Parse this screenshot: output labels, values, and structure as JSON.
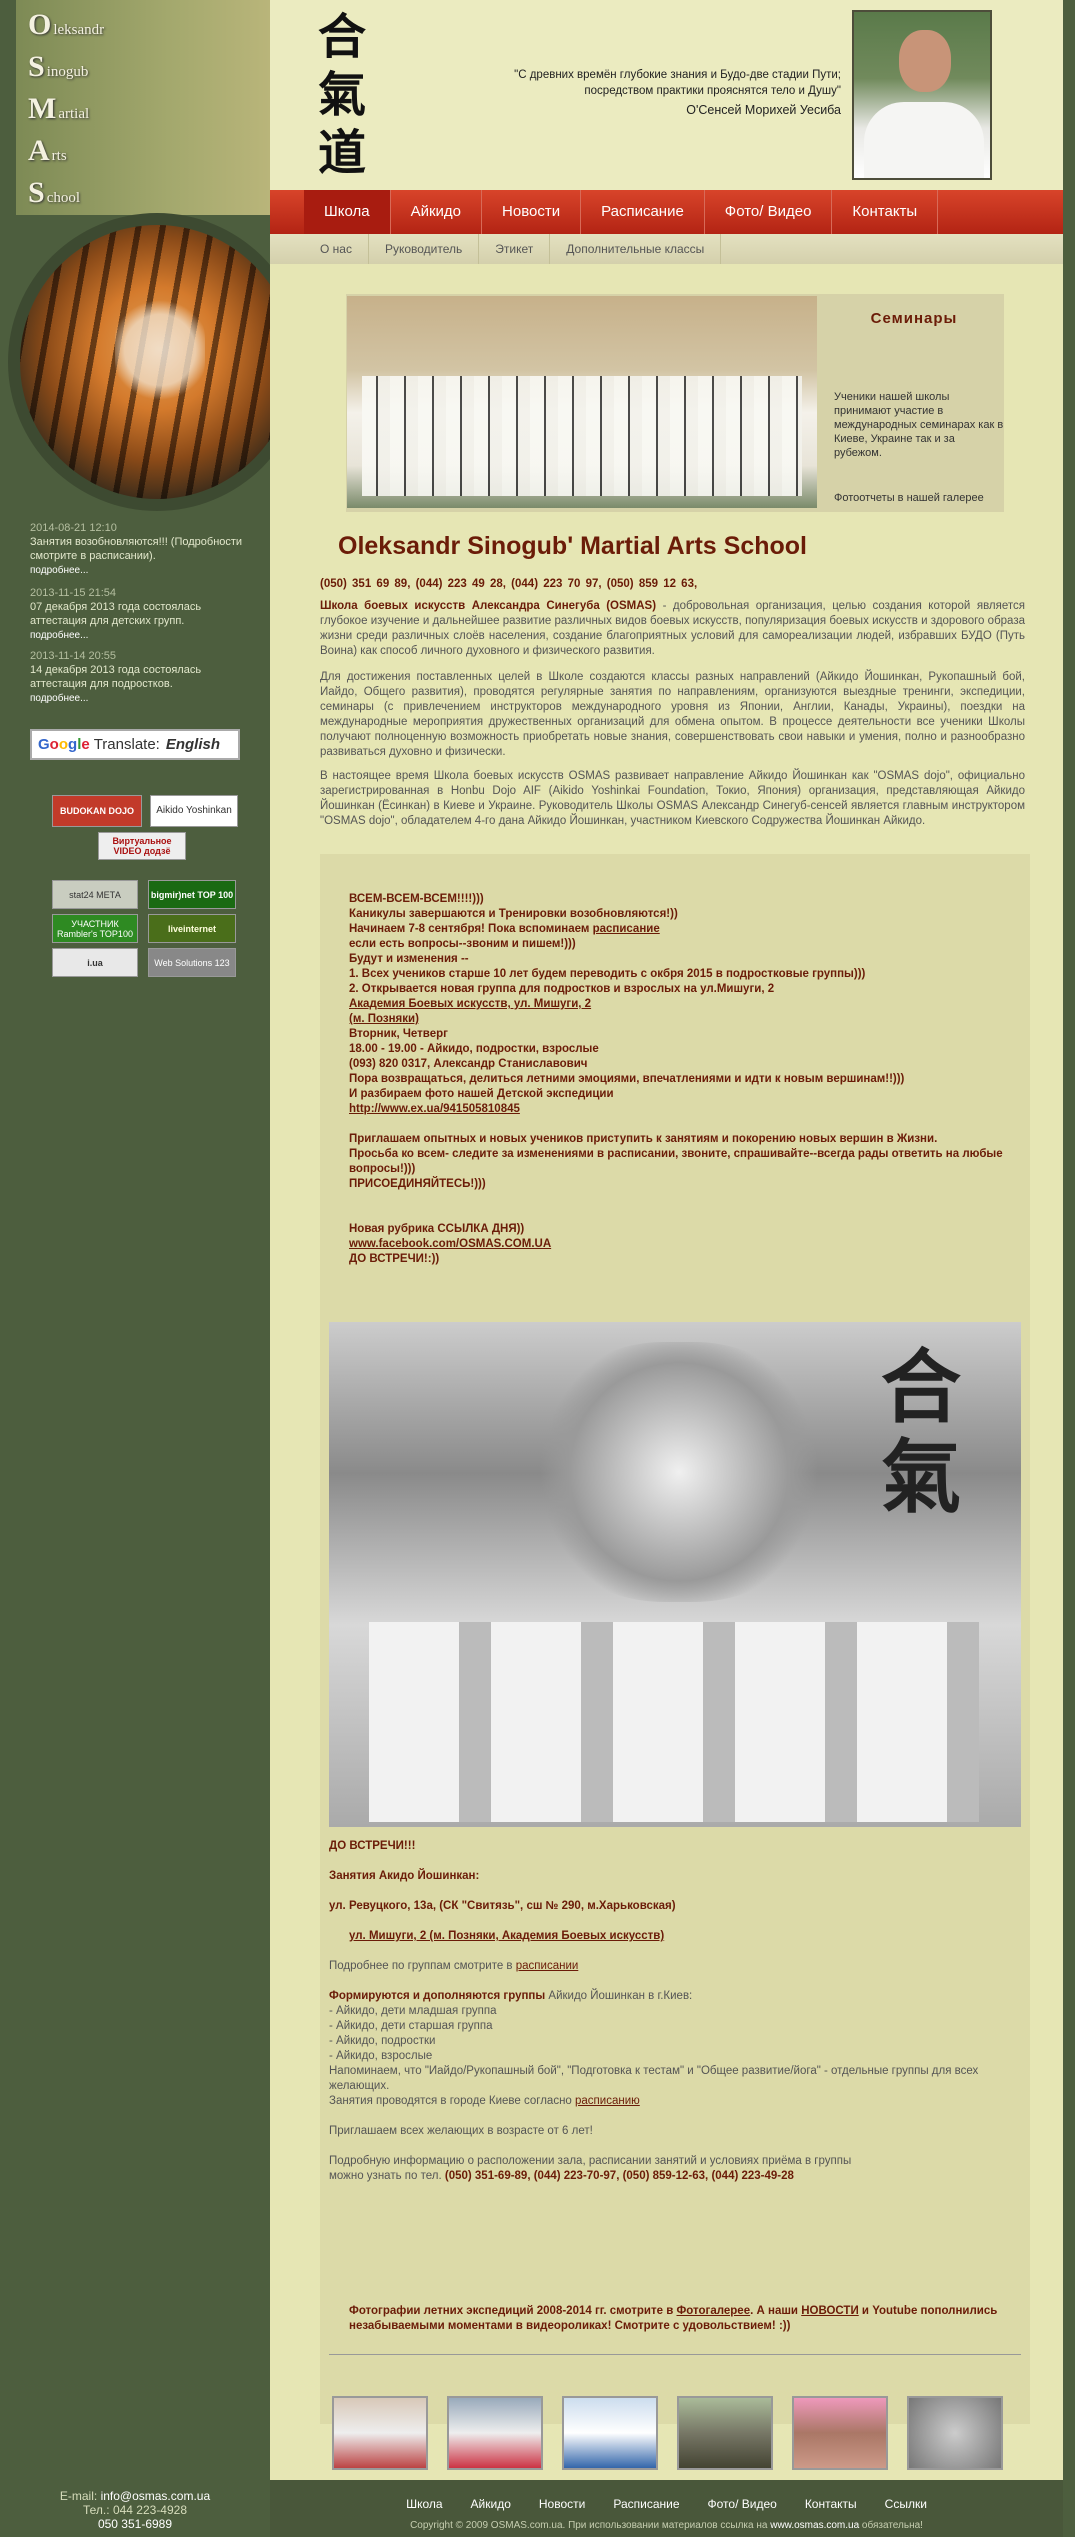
{
  "logo": [
    {
      "big": "O",
      "rest": "leksandr"
    },
    {
      "big": "S",
      "rest": "inogub"
    },
    {
      "big": "M",
      "rest": "artial"
    },
    {
      "big": "A",
      "rest": "rts"
    },
    {
      "big": "S",
      "rest": "chool"
    }
  ],
  "news": [
    {
      "date": "2014-08-21 12:10",
      "text": "Занятия возобновляются!!! (Подробности смотрите в расписании).",
      "more": "подробнее..."
    },
    {
      "date": "2013-11-15 21:54",
      "text": "07 декабря 2013 года состоялась аттестация для детских групп.",
      "more": "подробнее..."
    },
    {
      "date": "2013-11-14 20:55",
      "text": "14 декабря 2013 года состоялась аттестация для подростков.",
      "more": "подробнее..."
    }
  ],
  "translate": {
    "google": "Google",
    "label": "Translate:",
    "lang": "English"
  },
  "banners": {
    "budokan": "BUDOKAN DOJO",
    "aikido": "Aikido Yoshinkan",
    "video": "Виртуальное VIDEO додзё",
    "stat24": "stat24 МЕТА",
    "bigmir": "bigmir)net TOP 100",
    "rambler": "УЧАСТНИК Rambler's TOP100",
    "liveinternet": "liveinternet",
    "iua": "i.ua",
    "websolutions": "Web Solutions 123"
  },
  "sidebar_contacts": {
    "email_label": "E-mail:",
    "email": "info@osmas.com.ua",
    "tel_label": "Тел.:",
    "tel1": "044 223-4928",
    "tel2": "050 351-6989"
  },
  "header": {
    "kanji": [
      "合",
      "氣",
      "道"
    ],
    "quote_line1": "\"С древних времён глубокие знания и Будо-две стадии Пути;",
    "quote_line2": "посредством практики прояснятся тело и Душу\"",
    "quote_author": "О'Сенсей Морихей Уесиба"
  },
  "topnav": [
    "Школа",
    "Айкидо",
    "Новости",
    "Расписание",
    "Фото/ Видео",
    "Контакты"
  ],
  "subnav": [
    "О нас",
    "Руководитель",
    "Этикет",
    "Дополнительные классы"
  ],
  "seminars": {
    "title": "Семинары",
    "text": "Ученики нашей школы принимают участие в международных семинарах как в Киеве, Украине так и за рубежом.",
    "gallery": "Фотоотчеты в нашей галерее"
  },
  "school_title": "Oleksandr Sinogub' Martial Arts School",
  "phones": "(050) 351 69 89,   (044) 223 49 28,   (044) 223 70 97,    (050) 859 12 63,",
  "para1_bold": "Школа боевых искусств Александра Синегуба (OSMAS)",
  "para1": " - добровольная организация, целью создания которой является глубокое изучение и дальнейшее развитие различных видов боевых искусств, популяризация боевых искусств и здорового образа жизни среди различных слоёв населения, создание благоприятных условий для самореализации людей, избравших БУДО (Путь Воина) как способ личного духовного и физического развития.",
  "para2": "Для достижения поставленных целей в Школе создаются классы разных направлений (Айкидо Йошинкан, Рукопашный бой, Иайдо, Общего развития), проводятся регулярные занятия по направлениям, организуются выездные тренинги, экспедиции, семинары (с привлечением инструкторов международного уровня из Японии, Англии, Канады, Украины), поездки на международные мероприятия дружественных организаций для обмена опытом. В процессе деятельности все ученики Школы получают полноценную возможность приобретать новые знания, совершенствовать свои навыки и умения, полно и разнообразно развиваться духовно и физически.",
  "para3": "В настоящее время Школа боевых искусств OSMAS развивает направление Айкидо Йошинкан как \"OSMAS dojo\", официально зарегистрированная в Honbu Dojo AIF (Aikido Yoshinkai Foundation, Токио, Япония) организация, представляющая Айкидо Йошинкан (Ёсинкан) в Киеве и Украине. Руководитель Школы OSMAS Александр Синегуб-сенсей является главным инструктором \"OSMAS dojo\", обладателем 4-го дана Айкидо Йошинкан, участником  Киевского Содружества Йошинкан Айкидо.",
  "announce": {
    "l1": "ВСЕМ-ВСЕМ-ВСЕМ!!!!)))",
    "l2": " Каникулы завершаются и Тренировки возобновляются!))",
    "l3a": "Начинаем 7-8 сентября! Пока вспоминаем ",
    "l3link": "расписание",
    "l4": "если есть вопросы--звоним и пишем!)))",
    "l5": "Будут и изменения --",
    "l6": "1. Всех учеников старше 10 лет будем переводить с окбря 2015 в подростковые группы)))",
    "l7": "2. Открывается новая группа для подростков и взрослых на ул.Мишуги, 2",
    "l8": "Академия Боевых искусств, ул. Мишуги, 2",
    "l9": "(м. Позняки)",
    "l10": "Вторник, Четверг",
    "l11": "18.00 - 19.00 - Айкидо, подростки, взрослые",
    "l12": "(093) 820 0317, Александр Станиславович",
    "l13": "Пора возвращаться, делиться летними эмоциями, впечатлениями и идти к новым вершинам!!)))",
    "l14": "И разбираем фото нашей Детской экспедиции",
    "l15": "http://www.ex.ua/941505810845",
    "l16": "Приглашаем опытных и новых учеников приступить к занятиям и покорению новых вершин в Жизни.",
    "l17": "Просьба ко всем- следите за изменениями в расписании, звоните, спрашивайте--всегда рады ответить на любые вопросы!)))",
    "l18": "ПРИСОЕДИНЯЙТЕСЬ!)))",
    "l19": "Новая рубрика ССЫЛКА ДНЯ))",
    "l20": "www.facebook.com/OSMAS.COM.UA",
    "l21": "ДО ВСТРЕЧИ!:))"
  },
  "details": {
    "d1": "ДО ВСТРЕЧИ!!!",
    "d2": "Занятия Акидо Йошинкан:",
    "d3": "ул. Ревуцкого, 13а, (СК \"Свитязь\", сш № 290, м.Харьковская)",
    "d4": "ул. Мишуги, 2 (м. Позняки, Академия Боевых искусств)",
    "d5a": "Подробнее по группам смотрите в ",
    "d5link": "расписании",
    "d6a": "Формируются и дополняются группы",
    "d6b": " Айкидо Йошинкан в г.Киев:",
    "d7": "- Айкидо, дети младшая группа",
    "d8": "- Айкидо, дети старшая группа",
    "d9": "- Айкидо, подростки",
    "d10": "- Айкидо, взрослые",
    "d11": "Напоминаем, что \"Иайдо/Рукопашный бой\", \"Подготовка к тестам\" и \"Общее развитие/йога\" - отдельные группы для всех желающих.",
    "d12a": "Занятия проводятся в городе Киеве согласно ",
    "d12link": "расписанию",
    "d13": "Приглашаем всех желающих в возрасте от 6 лет!",
    "d14": "Подробную информацию о расположении зала, расписании занятий и условиях приёма в группы",
    "d15a": "можно узнать по тел. ",
    "d15b": "(050) 351-69-89, (044) 223-70-97, (050) 859-12-63, (044) 223-49-28"
  },
  "photos_note": {
    "a": "Фотографии летних экспедиций 2008-2014 гг. смотрите в ",
    "gallery": "Фотогалерее",
    "b": ". А наши ",
    "news": "НОВОСТИ",
    "c": " и Youtube пополнились незабываемыми моментами в видеороликах! Смотрите с удовольствием! :))"
  },
  "footer_nav": [
    "Школа",
    "Айкидо",
    "Новости",
    "Расписание",
    "Фото/ Видео",
    "Контакты",
    "Ссылки"
  ],
  "copyright": {
    "a": "Copyright © 2009 OSMAS.com.ua. ",
    "b": "При использовании материалов ссылка на ",
    "site": "www.osmas.com.ua",
    "c": " обязательна!"
  }
}
